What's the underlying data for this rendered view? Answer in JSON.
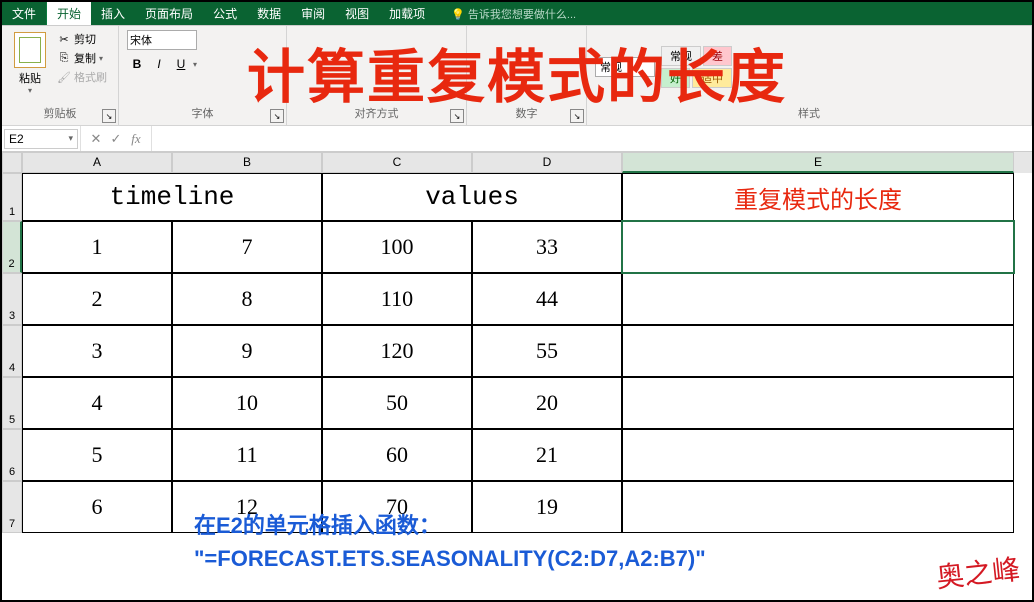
{
  "tabs": {
    "file": "文件",
    "home": "开始",
    "insert": "插入",
    "page_layout": "页面布局",
    "formulas": "公式",
    "data": "数据",
    "review": "审阅",
    "view": "视图",
    "addins": "加载项",
    "tell_me": "告诉我您想要做什么..."
  },
  "ribbon": {
    "clipboard": {
      "label": "剪贴板",
      "paste": "粘贴",
      "cut": "剪切",
      "copy": "复制",
      "format_painter": "格式刷"
    },
    "font": {
      "label": "字体",
      "font_name": "宋体",
      "bold": "B",
      "italic": "I",
      "underline": "U"
    },
    "alignment": {
      "label": "对齐方式"
    },
    "number": {
      "label": "数字",
      "format": "常规"
    },
    "styles": {
      "label": "样式",
      "normal": "常规",
      "bad": "差",
      "good": "好",
      "neutral": "适中"
    }
  },
  "formula_bar": {
    "name_box": "E2",
    "formula": ""
  },
  "columns": [
    "A",
    "B",
    "C",
    "D",
    "E"
  ],
  "headers": {
    "timeline": "timeline",
    "values": "values",
    "pattern_length": "重复模式的长度"
  },
  "rows": [
    {
      "A": "1",
      "B": "7",
      "C": "100",
      "D": "33"
    },
    {
      "A": "2",
      "B": "8",
      "C": "110",
      "D": "44"
    },
    {
      "A": "3",
      "B": "9",
      "C": "120",
      "D": "55"
    },
    {
      "A": "4",
      "B": "10",
      "C": "50",
      "D": "20"
    },
    {
      "A": "5",
      "B": "11",
      "C": "60",
      "D": "21"
    },
    {
      "A": "6",
      "B": "12",
      "C": "70",
      "D": "19"
    }
  ],
  "overlay_title": "计算重复模式的长度",
  "annotation": {
    "line1": "在E2的单元格插入函数：",
    "line2": "\"=FORECAST.ETS.SEASONALITY(C2:D7,A2:B7)\""
  },
  "signature": "奥之峰",
  "active_cell": "E2"
}
